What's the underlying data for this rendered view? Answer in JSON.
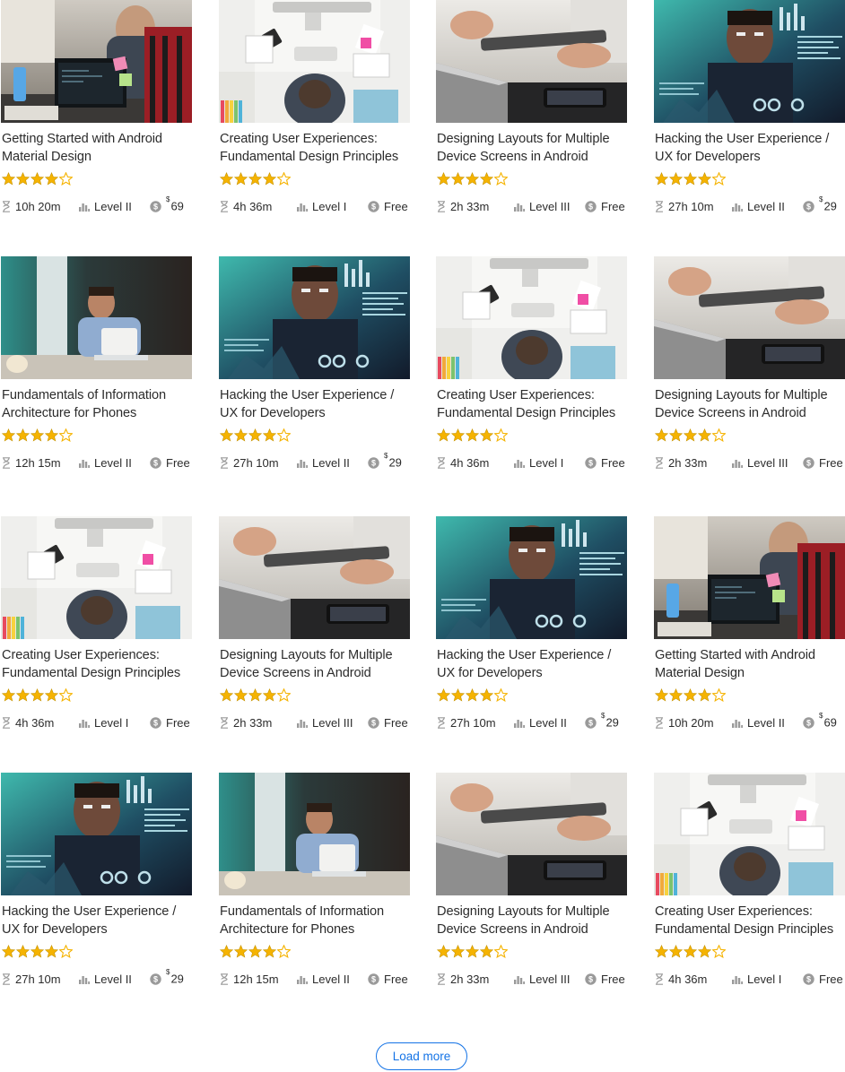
{
  "colors": {
    "star": "#f5b301",
    "star_outline": "#c79400",
    "accent": "#1473e6",
    "meta_icon": "#9a9a9a"
  },
  "icons": {
    "rating": "star-icon",
    "duration": "hourglass-icon",
    "level": "bar-chart-icon",
    "price": "dollar-coin-icon"
  },
  "courses": [
    {
      "title": "Getting Started with Android Material Design",
      "image": "office-laptop",
      "rating": 4,
      "duration": "10h 20m",
      "level": "Level II",
      "price": {
        "currency": "$",
        "amount": "69",
        "free": false
      }
    },
    {
      "title": "Creating User Experiences: Fundamental Design Principles",
      "image": "desk-overhead",
      "rating": 4,
      "duration": "4h 36m",
      "level": "Level I",
      "price": {
        "currency": "",
        "amount": "Free",
        "free": true
      }
    },
    {
      "title": "Designing Layouts for Multiple Device Screens in Android",
      "image": "tablet-hands",
      "rating": 4,
      "duration": "2h 33m",
      "level": "Level III",
      "price": {
        "currency": "",
        "amount": "Free",
        "free": true
      }
    },
    {
      "title": "Hacking the User Experience / UX for Developers",
      "image": "code-overlay",
      "rating": 4,
      "duration": "27h 10m",
      "level": "Level II",
      "price": {
        "currency": "$",
        "amount": "29",
        "free": false
      }
    },
    {
      "title": "Fundamentals of Information Architecture for Phones",
      "image": "phone-call",
      "rating": 4,
      "duration": "12h 15m",
      "level": "Level II",
      "price": {
        "currency": "",
        "amount": "Free",
        "free": true
      }
    },
    {
      "title": "Hacking the User Experience / UX for Developers",
      "image": "code-overlay",
      "rating": 4,
      "duration": "27h 10m",
      "level": "Level II",
      "price": {
        "currency": "$",
        "amount": "29",
        "free": false
      }
    },
    {
      "title": "Creating User Experiences: Fundamental Design Principles",
      "image": "desk-overhead",
      "rating": 4,
      "duration": "4h 36m",
      "level": "Level I",
      "price": {
        "currency": "",
        "amount": "Free",
        "free": true
      }
    },
    {
      "title": "Designing Layouts for Multiple Device Screens in Android",
      "image": "tablet-hands",
      "rating": 4,
      "duration": "2h 33m",
      "level": "Level III",
      "price": {
        "currency": "",
        "amount": "Free",
        "free": true
      }
    },
    {
      "title": "Creating User Experiences: Fundamental Design Principles",
      "image": "desk-overhead",
      "rating": 4,
      "duration": "4h 36m",
      "level": "Level I",
      "price": {
        "currency": "",
        "amount": "Free",
        "free": true
      }
    },
    {
      "title": "Designing Layouts for Multiple Device Screens in Android",
      "image": "tablet-hands",
      "rating": 4,
      "duration": "2h 33m",
      "level": "Level III",
      "price": {
        "currency": "",
        "amount": "Free",
        "free": true
      }
    },
    {
      "title": "Hacking the User Experience / UX for Developers",
      "image": "code-overlay",
      "rating": 4,
      "duration": "27h 10m",
      "level": "Level II",
      "price": {
        "currency": "$",
        "amount": "29",
        "free": false
      }
    },
    {
      "title": "Getting Started with Android Material Design",
      "image": "office-laptop",
      "rating": 4,
      "duration": "10h 20m",
      "level": "Level II",
      "price": {
        "currency": "$",
        "amount": "69",
        "free": false
      }
    },
    {
      "title": "Hacking the User Experience / UX for Developers",
      "image": "code-overlay",
      "rating": 4,
      "duration": "27h 10m",
      "level": "Level II",
      "price": {
        "currency": "$",
        "amount": "29",
        "free": false
      }
    },
    {
      "title": "Fundamentals of Information Architecture for Phones",
      "image": "phone-call",
      "rating": 4,
      "duration": "12h 15m",
      "level": "Level II",
      "price": {
        "currency": "",
        "amount": "Free",
        "free": true
      }
    },
    {
      "title": "Designing Layouts for Multiple Device Screens in Android",
      "image": "tablet-hands",
      "rating": 4,
      "duration": "2h 33m",
      "level": "Level III",
      "price": {
        "currency": "",
        "amount": "Free",
        "free": true
      }
    },
    {
      "title": "Creating User Experiences: Fundamental Design Principles",
      "image": "desk-overhead",
      "rating": 4,
      "duration": "4h 36m",
      "level": "Level I",
      "price": {
        "currency": "",
        "amount": "Free",
        "free": true
      }
    }
  ],
  "load_more": {
    "label": "Load more"
  }
}
